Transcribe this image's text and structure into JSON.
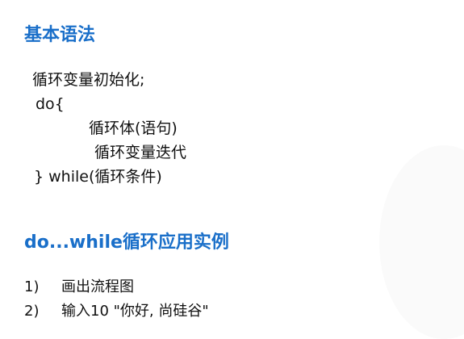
{
  "section1": {
    "title": "基本语法"
  },
  "code": {
    "lines": [
      "循环变量初始化;",
      "do{",
      "循环体(语句)",
      "循环变量迭代",
      "} while(循环条件)"
    ]
  },
  "section2": {
    "title": "do...while循环应用实例"
  },
  "examples": [
    {
      "num": "1)",
      "text": "画出流程图"
    },
    {
      "num": "2)",
      "text": "输入10 \"你好, 尚硅谷\""
    }
  ],
  "colors": {
    "heading": "#1a6fc9",
    "text": "#111111"
  }
}
